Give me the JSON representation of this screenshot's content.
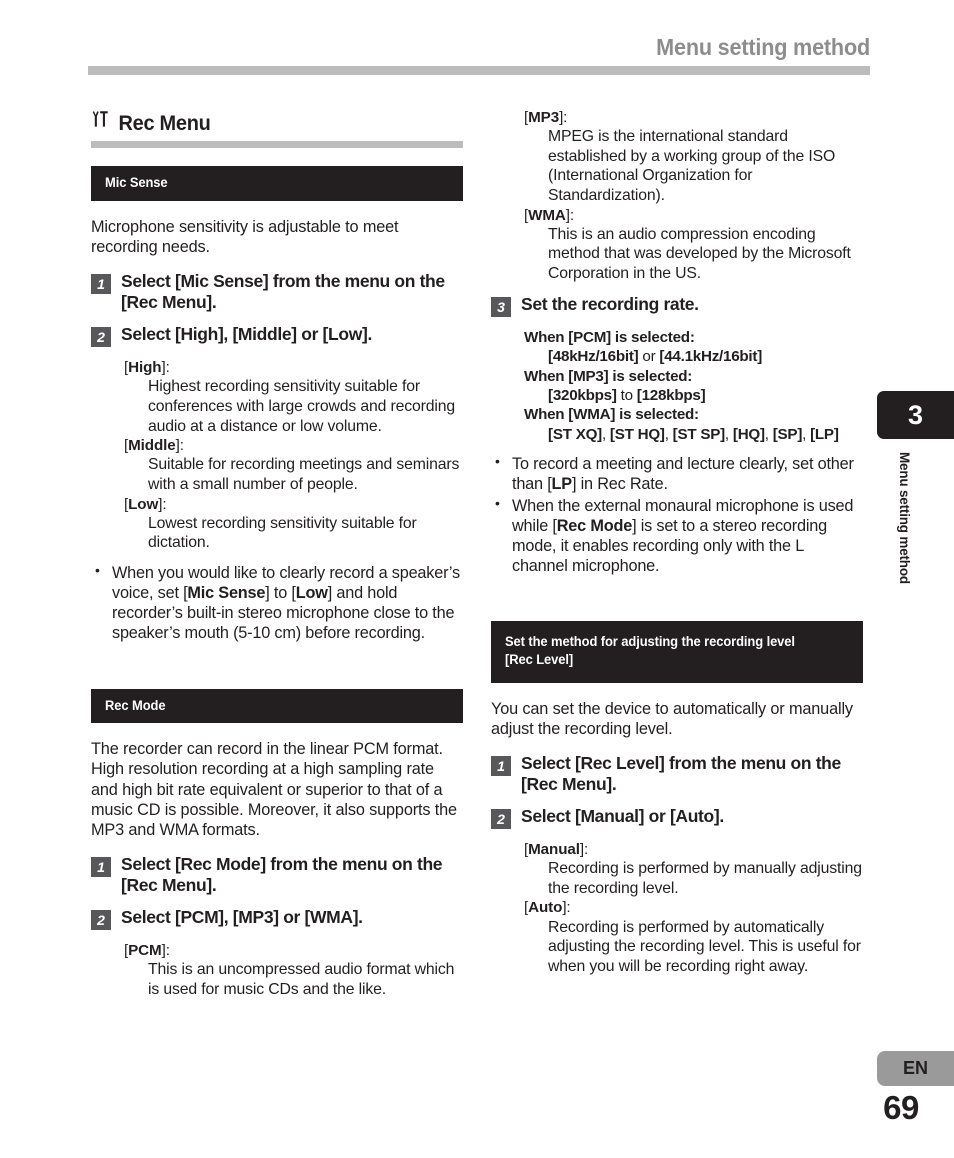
{
  "header": {
    "title": "Menu setting method"
  },
  "section": {
    "icon": "tools-icon",
    "title": "Rec Menu"
  },
  "left_column": {
    "mic_sense": {
      "bar_label": "Mic Sense",
      "intro": "Microphone sensitivity is adjustable to meet recording needs.",
      "steps": [
        {
          "num": "1",
          "html": "Select [<b>Mic Sense</b>] from the menu on the [<b>Rec Menu</b>]."
        },
        {
          "num": "2",
          "html": "Select [<b>High</b>], [<b>Middle</b>] or [<b>Low</b>]."
        }
      ],
      "definitions": [
        {
          "term": "[<b>High</b>]:",
          "body": "Highest recording sensitivity suitable for conferences with large crowds and recording audio at a distance or low volume."
        },
        {
          "term": "[<b>Middle</b>]:",
          "body": "Suitable for recording meetings and seminars with a small number of people."
        },
        {
          "term": "[<b>Low</b>]:",
          "body": "Lowest recording sensitivity suitable for dictation."
        }
      ],
      "notes": [
        "When you would like to clearly record a speaker’s voice, set [<b>Mic Sense</b>] to [<b>Low</b>] and hold recorder’s built-in stereo microphone close to the speaker’s mouth (5-10 cm) before recording."
      ]
    },
    "rec_mode": {
      "bar_label": "Rec Mode",
      "intro": "The recorder can record in the linear PCM format. High resolution recording at a high sampling rate and high bit rate equivalent or superior to that of a music CD is possible. Moreover, it also supports the MP3 and WMA formats.",
      "steps": [
        {
          "num": "1",
          "html": "Select [<b>Rec Mode</b>] from the menu on the [<b>Rec Menu</b>]."
        },
        {
          "num": "2",
          "html": "Select [<b>PCM</b>], [<b>MP3</b>] or [<b>WMA</b>]."
        }
      ],
      "definitions": [
        {
          "term": "[<b>PCM</b>]:",
          "body": "This is an uncompressed audio format which is used for music CDs and the like."
        }
      ]
    }
  },
  "right_column": {
    "rec_mode_cont": {
      "definitions": [
        {
          "term": "[<b>MP3</b>]:",
          "body": "MPEG is the international standard established by a working group of the ISO (International Organization for Standardization)."
        },
        {
          "term": "[<b>WMA</b>]:",
          "body": "This is an audio compression encoding method that was developed by the Microsoft Corporation in the US."
        }
      ],
      "step3": {
        "num": "3",
        "html": "Set the recording rate."
      },
      "rate_groups": [
        {
          "when": "When [<b>PCM</b>] is selected:",
          "values": "[<b>48kHz/16bit</b>] <span class=\"reg\">or</span> [<b>44.1kHz/16bit</b>]"
        },
        {
          "when": "When [<b>MP3</b>] is selected:",
          "values": "[<b>320kbps</b>] <span class=\"reg\">to</span> [<b>128kbps</b>]"
        },
        {
          "when": "When [<b>WMA</b>] is selected:",
          "values": "[<b>ST XQ</b>]<span class=\"reg\">,</span> [<b>ST HQ</b>]<span class=\"reg\">,</span> [<b>ST SP</b>]<span class=\"reg\">,</span> [<b>HQ</b>]<span class=\"reg\">,</span> [<b>SP</b>]<span class=\"reg\">,</span> [<b>LP</b>]"
        }
      ],
      "notes": [
        "To record a meeting and lecture clearly, set other than [<b>LP</b>] in Rec Rate.",
        "When the external monaural microphone is used while [<b>Rec Mode</b>] is set to a stereo recording mode, it enables recording only with the L channel microphone."
      ]
    },
    "rec_level": {
      "bar_label_line1": "Set the method for adjusting the recording level",
      "bar_label_line2": "[Rec Level]",
      "intro": "You can set the device to automatically or manually adjust the recording level.",
      "steps": [
        {
          "num": "1",
          "html": "Select [<b>Rec Level</b>] from the menu on the [<b>Rec Menu</b>]."
        },
        {
          "num": "2",
          "html": "Select [<b>Manual</b>] or [<b>Auto</b>]."
        }
      ],
      "definitions": [
        {
          "term": "[<b>Manual</b>]:",
          "body": "Recording is performed by manually adjusting the recording level."
        },
        {
          "term": "[<b>Auto</b>]:",
          "body": "Recording is performed by automatically adjusting the recording level. This is useful for when you will be recording right away."
        }
      ]
    }
  },
  "chapter_tab": {
    "number": "3",
    "label": "Menu setting method"
  },
  "footer": {
    "language": "EN",
    "page_number": "69"
  },
  "colors": {
    "bar_black": "#231f20",
    "rule_gray": "#bcbcbc",
    "step_gray": "#58585a",
    "header_gray": "#8d8d8d",
    "en_gray": "#9a9a9a"
  }
}
